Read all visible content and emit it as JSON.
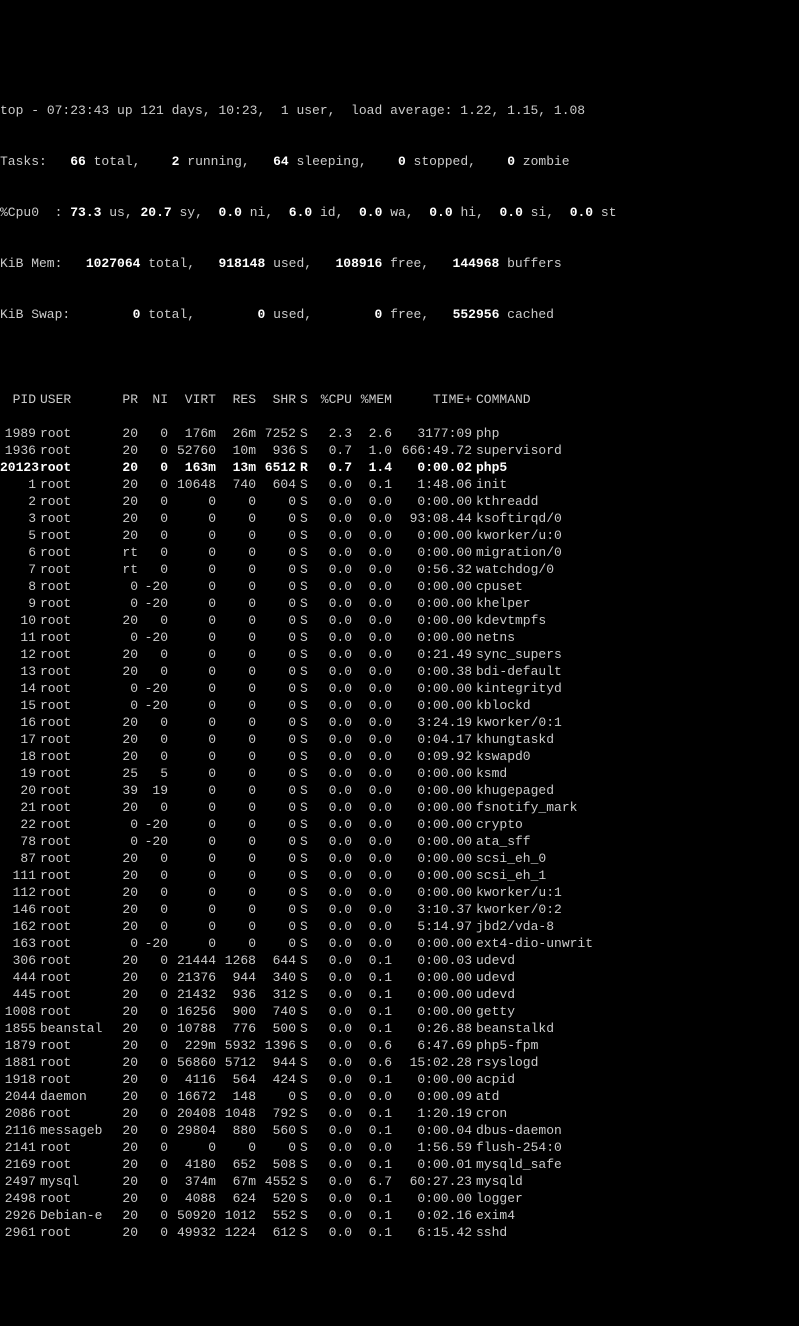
{
  "summary": {
    "line1_prefix": "top - ",
    "line1_time": "07:23:43 up 121 days, 10:23,  1 user,  load average: 1.22, 1.15, 1.08",
    "tasks_label": "Tasks:",
    "tasks_total": "66",
    "tasks_total_label": " total,",
    "tasks_running": "2",
    "tasks_running_label": " running,",
    "tasks_sleeping": "64",
    "tasks_sleeping_label": " sleeping,",
    "tasks_stopped": "0",
    "tasks_stopped_label": " stopped,",
    "tasks_zombie": "0",
    "tasks_zombie_label": " zombie",
    "cpu_label": "%Cpu0  :",
    "cpu_us": "73.3",
    "cpu_us_label": " us,",
    "cpu_sy": "20.7",
    "cpu_sy_label": " sy,",
    "cpu_ni": "0.0",
    "cpu_ni_label": " ni,",
    "cpu_id": "6.0",
    "cpu_id_label": " id,",
    "cpu_wa": "0.0",
    "cpu_wa_label": " wa,",
    "cpu_hi": "0.0",
    "cpu_hi_label": " hi,",
    "cpu_si": "0.0",
    "cpu_si_label": " si,",
    "cpu_st": "0.0",
    "cpu_st_label": " st",
    "mem_label": "KiB Mem:",
    "mem_total": "1027064",
    "mem_total_label": " total,",
    "mem_used": "918148",
    "mem_used_label": " used,",
    "mem_free": "108916",
    "mem_free_label": " free,",
    "mem_buffers": "144968",
    "mem_buffers_label": " buffers",
    "swap_label": "KiB Swap:",
    "swap_total": "0",
    "swap_total_label": " total,",
    "swap_used": "0",
    "swap_used_label": " used,",
    "swap_free": "0",
    "swap_free_label": " free,",
    "swap_cached": "552956",
    "swap_cached_label": " cached"
  },
  "headers": {
    "pid": "PID",
    "user": "USER",
    "pr": "PR",
    "ni": "NI",
    "virt": "VIRT",
    "res": "RES",
    "shr": "SHR",
    "s": "S",
    "cpu": "%CPU",
    "mem": "%MEM",
    "time": "TIME+",
    "cmd": "COMMAND"
  },
  "processes": [
    {
      "pid": "1989",
      "user": "root",
      "pr": "20",
      "ni": "0",
      "virt": "176m",
      "res": "26m",
      "shr": "7252",
      "s": "S",
      "cpu": "2.3",
      "mem": "2.6",
      "time": "3177:09",
      "cmd": "php",
      "hl": false
    },
    {
      "pid": "1936",
      "user": "root",
      "pr": "20",
      "ni": "0",
      "virt": "52760",
      "res": "10m",
      "shr": "936",
      "s": "S",
      "cpu": "0.7",
      "mem": "1.0",
      "time": "666:49.72",
      "cmd": "supervisord",
      "hl": false
    },
    {
      "pid": "20123",
      "user": "root",
      "pr": "20",
      "ni": "0",
      "virt": "163m",
      "res": "13m",
      "shr": "6512",
      "s": "R",
      "cpu": "0.7",
      "mem": "1.4",
      "time": "0:00.02",
      "cmd": "php5",
      "hl": true
    },
    {
      "pid": "1",
      "user": "root",
      "pr": "20",
      "ni": "0",
      "virt": "10648",
      "res": "740",
      "shr": "604",
      "s": "S",
      "cpu": "0.0",
      "mem": "0.1",
      "time": "1:48.06",
      "cmd": "init",
      "hl": false
    },
    {
      "pid": "2",
      "user": "root",
      "pr": "20",
      "ni": "0",
      "virt": "0",
      "res": "0",
      "shr": "0",
      "s": "S",
      "cpu": "0.0",
      "mem": "0.0",
      "time": "0:00.00",
      "cmd": "kthreadd",
      "hl": false
    },
    {
      "pid": "3",
      "user": "root",
      "pr": "20",
      "ni": "0",
      "virt": "0",
      "res": "0",
      "shr": "0",
      "s": "S",
      "cpu": "0.0",
      "mem": "0.0",
      "time": "93:08.44",
      "cmd": "ksoftirqd/0",
      "hl": false
    },
    {
      "pid": "5",
      "user": "root",
      "pr": "20",
      "ni": "0",
      "virt": "0",
      "res": "0",
      "shr": "0",
      "s": "S",
      "cpu": "0.0",
      "mem": "0.0",
      "time": "0:00.00",
      "cmd": "kworker/u:0",
      "hl": false
    },
    {
      "pid": "6",
      "user": "root",
      "pr": "rt",
      "ni": "0",
      "virt": "0",
      "res": "0",
      "shr": "0",
      "s": "S",
      "cpu": "0.0",
      "mem": "0.0",
      "time": "0:00.00",
      "cmd": "migration/0",
      "hl": false
    },
    {
      "pid": "7",
      "user": "root",
      "pr": "rt",
      "ni": "0",
      "virt": "0",
      "res": "0",
      "shr": "0",
      "s": "S",
      "cpu": "0.0",
      "mem": "0.0",
      "time": "0:56.32",
      "cmd": "watchdog/0",
      "hl": false
    },
    {
      "pid": "8",
      "user": "root",
      "pr": "0",
      "ni": "-20",
      "virt": "0",
      "res": "0",
      "shr": "0",
      "s": "S",
      "cpu": "0.0",
      "mem": "0.0",
      "time": "0:00.00",
      "cmd": "cpuset",
      "hl": false
    },
    {
      "pid": "9",
      "user": "root",
      "pr": "0",
      "ni": "-20",
      "virt": "0",
      "res": "0",
      "shr": "0",
      "s": "S",
      "cpu": "0.0",
      "mem": "0.0",
      "time": "0:00.00",
      "cmd": "khelper",
      "hl": false
    },
    {
      "pid": "10",
      "user": "root",
      "pr": "20",
      "ni": "0",
      "virt": "0",
      "res": "0",
      "shr": "0",
      "s": "S",
      "cpu": "0.0",
      "mem": "0.0",
      "time": "0:00.00",
      "cmd": "kdevtmpfs",
      "hl": false
    },
    {
      "pid": "11",
      "user": "root",
      "pr": "0",
      "ni": "-20",
      "virt": "0",
      "res": "0",
      "shr": "0",
      "s": "S",
      "cpu": "0.0",
      "mem": "0.0",
      "time": "0:00.00",
      "cmd": "netns",
      "hl": false
    },
    {
      "pid": "12",
      "user": "root",
      "pr": "20",
      "ni": "0",
      "virt": "0",
      "res": "0",
      "shr": "0",
      "s": "S",
      "cpu": "0.0",
      "mem": "0.0",
      "time": "0:21.49",
      "cmd": "sync_supers",
      "hl": false
    },
    {
      "pid": "13",
      "user": "root",
      "pr": "20",
      "ni": "0",
      "virt": "0",
      "res": "0",
      "shr": "0",
      "s": "S",
      "cpu": "0.0",
      "mem": "0.0",
      "time": "0:00.38",
      "cmd": "bdi-default",
      "hl": false
    },
    {
      "pid": "14",
      "user": "root",
      "pr": "0",
      "ni": "-20",
      "virt": "0",
      "res": "0",
      "shr": "0",
      "s": "S",
      "cpu": "0.0",
      "mem": "0.0",
      "time": "0:00.00",
      "cmd": "kintegrityd",
      "hl": false
    },
    {
      "pid": "15",
      "user": "root",
      "pr": "0",
      "ni": "-20",
      "virt": "0",
      "res": "0",
      "shr": "0",
      "s": "S",
      "cpu": "0.0",
      "mem": "0.0",
      "time": "0:00.00",
      "cmd": "kblockd",
      "hl": false
    },
    {
      "pid": "16",
      "user": "root",
      "pr": "20",
      "ni": "0",
      "virt": "0",
      "res": "0",
      "shr": "0",
      "s": "S",
      "cpu": "0.0",
      "mem": "0.0",
      "time": "3:24.19",
      "cmd": "kworker/0:1",
      "hl": false
    },
    {
      "pid": "17",
      "user": "root",
      "pr": "20",
      "ni": "0",
      "virt": "0",
      "res": "0",
      "shr": "0",
      "s": "S",
      "cpu": "0.0",
      "mem": "0.0",
      "time": "0:04.17",
      "cmd": "khungtaskd",
      "hl": false
    },
    {
      "pid": "18",
      "user": "root",
      "pr": "20",
      "ni": "0",
      "virt": "0",
      "res": "0",
      "shr": "0",
      "s": "S",
      "cpu": "0.0",
      "mem": "0.0",
      "time": "0:09.92",
      "cmd": "kswapd0",
      "hl": false
    },
    {
      "pid": "19",
      "user": "root",
      "pr": "25",
      "ni": "5",
      "virt": "0",
      "res": "0",
      "shr": "0",
      "s": "S",
      "cpu": "0.0",
      "mem": "0.0",
      "time": "0:00.00",
      "cmd": "ksmd",
      "hl": false
    },
    {
      "pid": "20",
      "user": "root",
      "pr": "39",
      "ni": "19",
      "virt": "0",
      "res": "0",
      "shr": "0",
      "s": "S",
      "cpu": "0.0",
      "mem": "0.0",
      "time": "0:00.00",
      "cmd": "khugepaged",
      "hl": false
    },
    {
      "pid": "21",
      "user": "root",
      "pr": "20",
      "ni": "0",
      "virt": "0",
      "res": "0",
      "shr": "0",
      "s": "S",
      "cpu": "0.0",
      "mem": "0.0",
      "time": "0:00.00",
      "cmd": "fsnotify_mark",
      "hl": false
    },
    {
      "pid": "22",
      "user": "root",
      "pr": "0",
      "ni": "-20",
      "virt": "0",
      "res": "0",
      "shr": "0",
      "s": "S",
      "cpu": "0.0",
      "mem": "0.0",
      "time": "0:00.00",
      "cmd": "crypto",
      "hl": false
    },
    {
      "pid": "78",
      "user": "root",
      "pr": "0",
      "ni": "-20",
      "virt": "0",
      "res": "0",
      "shr": "0",
      "s": "S",
      "cpu": "0.0",
      "mem": "0.0",
      "time": "0:00.00",
      "cmd": "ata_sff",
      "hl": false
    },
    {
      "pid": "87",
      "user": "root",
      "pr": "20",
      "ni": "0",
      "virt": "0",
      "res": "0",
      "shr": "0",
      "s": "S",
      "cpu": "0.0",
      "mem": "0.0",
      "time": "0:00.00",
      "cmd": "scsi_eh_0",
      "hl": false
    },
    {
      "pid": "111",
      "user": "root",
      "pr": "20",
      "ni": "0",
      "virt": "0",
      "res": "0",
      "shr": "0",
      "s": "S",
      "cpu": "0.0",
      "mem": "0.0",
      "time": "0:00.00",
      "cmd": "scsi_eh_1",
      "hl": false
    },
    {
      "pid": "112",
      "user": "root",
      "pr": "20",
      "ni": "0",
      "virt": "0",
      "res": "0",
      "shr": "0",
      "s": "S",
      "cpu": "0.0",
      "mem": "0.0",
      "time": "0:00.00",
      "cmd": "kworker/u:1",
      "hl": false
    },
    {
      "pid": "146",
      "user": "root",
      "pr": "20",
      "ni": "0",
      "virt": "0",
      "res": "0",
      "shr": "0",
      "s": "S",
      "cpu": "0.0",
      "mem": "0.0",
      "time": "3:10.37",
      "cmd": "kworker/0:2",
      "hl": false
    },
    {
      "pid": "162",
      "user": "root",
      "pr": "20",
      "ni": "0",
      "virt": "0",
      "res": "0",
      "shr": "0",
      "s": "S",
      "cpu": "0.0",
      "mem": "0.0",
      "time": "5:14.97",
      "cmd": "jbd2/vda-8",
      "hl": false
    },
    {
      "pid": "163",
      "user": "root",
      "pr": "0",
      "ni": "-20",
      "virt": "0",
      "res": "0",
      "shr": "0",
      "s": "S",
      "cpu": "0.0",
      "mem": "0.0",
      "time": "0:00.00",
      "cmd": "ext4-dio-unwrit",
      "hl": false
    },
    {
      "pid": "306",
      "user": "root",
      "pr": "20",
      "ni": "0",
      "virt": "21444",
      "res": "1268",
      "shr": "644",
      "s": "S",
      "cpu": "0.0",
      "mem": "0.1",
      "time": "0:00.03",
      "cmd": "udevd",
      "hl": false
    },
    {
      "pid": "444",
      "user": "root",
      "pr": "20",
      "ni": "0",
      "virt": "21376",
      "res": "944",
      "shr": "340",
      "s": "S",
      "cpu": "0.0",
      "mem": "0.1",
      "time": "0:00.00",
      "cmd": "udevd",
      "hl": false
    },
    {
      "pid": "445",
      "user": "root",
      "pr": "20",
      "ni": "0",
      "virt": "21432",
      "res": "936",
      "shr": "312",
      "s": "S",
      "cpu": "0.0",
      "mem": "0.1",
      "time": "0:00.00",
      "cmd": "udevd",
      "hl": false
    },
    {
      "pid": "1008",
      "user": "root",
      "pr": "20",
      "ni": "0",
      "virt": "16256",
      "res": "900",
      "shr": "740",
      "s": "S",
      "cpu": "0.0",
      "mem": "0.1",
      "time": "0:00.00",
      "cmd": "getty",
      "hl": false
    },
    {
      "pid": "1855",
      "user": "beanstal",
      "pr": "20",
      "ni": "0",
      "virt": "10788",
      "res": "776",
      "shr": "500",
      "s": "S",
      "cpu": "0.0",
      "mem": "0.1",
      "time": "0:26.88",
      "cmd": "beanstalkd",
      "hl": false
    },
    {
      "pid": "1879",
      "user": "root",
      "pr": "20",
      "ni": "0",
      "virt": "229m",
      "res": "5932",
      "shr": "1396",
      "s": "S",
      "cpu": "0.0",
      "mem": "0.6",
      "time": "6:47.69",
      "cmd": "php5-fpm",
      "hl": false
    },
    {
      "pid": "1881",
      "user": "root",
      "pr": "20",
      "ni": "0",
      "virt": "56860",
      "res": "5712",
      "shr": "944",
      "s": "S",
      "cpu": "0.0",
      "mem": "0.6",
      "time": "15:02.28",
      "cmd": "rsyslogd",
      "hl": false
    },
    {
      "pid": "1918",
      "user": "root",
      "pr": "20",
      "ni": "0",
      "virt": "4116",
      "res": "564",
      "shr": "424",
      "s": "S",
      "cpu": "0.0",
      "mem": "0.1",
      "time": "0:00.00",
      "cmd": "acpid",
      "hl": false
    },
    {
      "pid": "2044",
      "user": "daemon",
      "pr": "20",
      "ni": "0",
      "virt": "16672",
      "res": "148",
      "shr": "0",
      "s": "S",
      "cpu": "0.0",
      "mem": "0.0",
      "time": "0:00.09",
      "cmd": "atd",
      "hl": false
    },
    {
      "pid": "2086",
      "user": "root",
      "pr": "20",
      "ni": "0",
      "virt": "20408",
      "res": "1048",
      "shr": "792",
      "s": "S",
      "cpu": "0.0",
      "mem": "0.1",
      "time": "1:20.19",
      "cmd": "cron",
      "hl": false
    },
    {
      "pid": "2116",
      "user": "messageb",
      "pr": "20",
      "ni": "0",
      "virt": "29804",
      "res": "880",
      "shr": "560",
      "s": "S",
      "cpu": "0.0",
      "mem": "0.1",
      "time": "0:00.04",
      "cmd": "dbus-daemon",
      "hl": false
    },
    {
      "pid": "2141",
      "user": "root",
      "pr": "20",
      "ni": "0",
      "virt": "0",
      "res": "0",
      "shr": "0",
      "s": "S",
      "cpu": "0.0",
      "mem": "0.0",
      "time": "1:56.59",
      "cmd": "flush-254:0",
      "hl": false
    },
    {
      "pid": "2169",
      "user": "root",
      "pr": "20",
      "ni": "0",
      "virt": "4180",
      "res": "652",
      "shr": "508",
      "s": "S",
      "cpu": "0.0",
      "mem": "0.1",
      "time": "0:00.01",
      "cmd": "mysqld_safe",
      "hl": false
    },
    {
      "pid": "2497",
      "user": "mysql",
      "pr": "20",
      "ni": "0",
      "virt": "374m",
      "res": "67m",
      "shr": "4552",
      "s": "S",
      "cpu": "0.0",
      "mem": "6.7",
      "time": "60:27.23",
      "cmd": "mysqld",
      "hl": false
    },
    {
      "pid": "2498",
      "user": "root",
      "pr": "20",
      "ni": "0",
      "virt": "4088",
      "res": "624",
      "shr": "520",
      "s": "S",
      "cpu": "0.0",
      "mem": "0.1",
      "time": "0:00.00",
      "cmd": "logger",
      "hl": false
    },
    {
      "pid": "2926",
      "user": "Debian-e",
      "pr": "20",
      "ni": "0",
      "virt": "50920",
      "res": "1012",
      "shr": "552",
      "s": "S",
      "cpu": "0.0",
      "mem": "0.1",
      "time": "0:02.16",
      "cmd": "exim4",
      "hl": false
    },
    {
      "pid": "2961",
      "user": "root",
      "pr": "20",
      "ni": "0",
      "virt": "49932",
      "res": "1224",
      "shr": "612",
      "s": "S",
      "cpu": "0.0",
      "mem": "0.1",
      "time": "6:15.42",
      "cmd": "sshd",
      "hl": false
    }
  ]
}
